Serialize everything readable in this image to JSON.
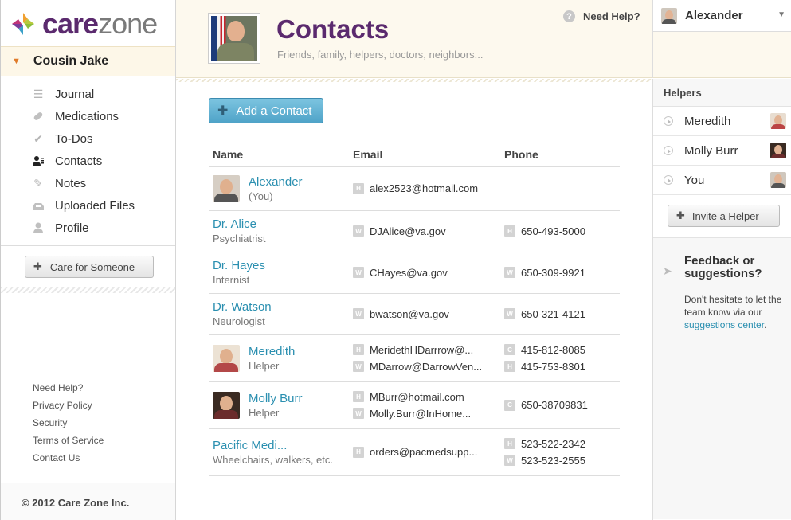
{
  "brand": {
    "care": "care",
    "zone": "zone"
  },
  "patient": {
    "name": "Cousin Jake"
  },
  "nav": [
    {
      "label": "Journal",
      "icon": "list-icon"
    },
    {
      "label": "Medications",
      "icon": "pill-icon"
    },
    {
      "label": "To-Dos",
      "icon": "check-icon"
    },
    {
      "label": "Contacts",
      "icon": "contacts-icon"
    },
    {
      "label": "Notes",
      "icon": "pencil-icon"
    },
    {
      "label": "Uploaded Files",
      "icon": "upload-icon"
    },
    {
      "label": "Profile",
      "icon": "person-icon"
    }
  ],
  "care_button": "Care for Someone",
  "footer_links": [
    "Need Help?",
    "Privacy Policy",
    "Security",
    "Terms of Service",
    "Contact Us"
  ],
  "copyright": "© 2012 Care Zone Inc.",
  "header": {
    "title": "Contacts",
    "subtitle": "Friends, family, helpers, doctors, neighbors...",
    "need_help": "Need Help?",
    "user": "Alexander"
  },
  "add_contact": "Add a Contact",
  "table": {
    "headers": {
      "name": "Name",
      "email": "Email",
      "phone": "Phone"
    },
    "rows": [
      {
        "name": "Alexander",
        "sub": "(You)",
        "emails": [
          {
            "tag": "H",
            "value": "alex2523@hotmail.com"
          }
        ],
        "phones": []
      },
      {
        "name": "Dr. Alice",
        "sub": "Psychiatrist",
        "emails": [
          {
            "tag": "W",
            "value": "DJAlice@va.gov"
          }
        ],
        "phones": [
          {
            "tag": "H",
            "value": "650-493-5000"
          }
        ]
      },
      {
        "name": "Dr. Hayes",
        "sub": "Internist",
        "emails": [
          {
            "tag": "W",
            "value": "CHayes@va.gov"
          }
        ],
        "phones": [
          {
            "tag": "W",
            "value": "650-309-9921"
          }
        ]
      },
      {
        "name": "Dr. Watson",
        "sub": "Neurologist",
        "emails": [
          {
            "tag": "W",
            "value": "bwatson@va.gov"
          }
        ],
        "phones": [
          {
            "tag": "W",
            "value": "650-321-4121"
          }
        ]
      },
      {
        "name": "Meredith",
        "sub": "Helper",
        "emails": [
          {
            "tag": "H",
            "value": "MeridethHDarrrow@..."
          },
          {
            "tag": "W",
            "value": "MDarrow@DarrowVen..."
          }
        ],
        "phones": [
          {
            "tag": "C",
            "value": "415-812-8085"
          },
          {
            "tag": "H",
            "value": "415-753-8301"
          }
        ]
      },
      {
        "name": "Molly Burr",
        "sub": "Helper",
        "emails": [
          {
            "tag": "H",
            "value": "MBurr@hotmail.com"
          },
          {
            "tag": "W",
            "value": "Molly.Burr@InHome..."
          }
        ],
        "phones": [
          {
            "tag": "C",
            "value": "650-38709831"
          }
        ]
      },
      {
        "name": "Pacific Medi...",
        "sub": "Wheelchairs, walkers, etc.",
        "emails": [
          {
            "tag": "H",
            "value": "orders@pacmedsupp..."
          }
        ],
        "phones": [
          {
            "tag": "H",
            "value": "523-522-2342"
          },
          {
            "tag": "W",
            "value": "523-523-2555"
          }
        ]
      }
    ]
  },
  "helpers": {
    "title": "Helpers",
    "items": [
      "Meredith",
      "Molly Burr",
      "You"
    ],
    "invite": "Invite a Helper"
  },
  "feedback": {
    "title": "Feedback or suggestions?",
    "text": "Don't hesitate to let the team know via our",
    "link": "suggestions center",
    "end": "."
  }
}
